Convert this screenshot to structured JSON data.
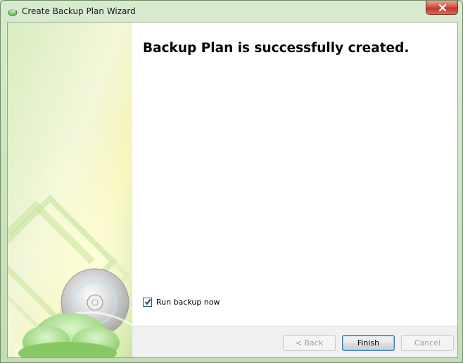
{
  "window": {
    "title": "Create Backup Plan Wizard"
  },
  "content": {
    "heading": "Backup Plan is successfully created.",
    "run_backup": {
      "label": "Run backup now",
      "checked": true
    }
  },
  "buttons": {
    "back": {
      "label": "< Back",
      "enabled": false
    },
    "finish": {
      "label": "Finish",
      "enabled": true,
      "default": true
    },
    "cancel": {
      "label": "Cancel",
      "enabled": false
    }
  },
  "colors": {
    "side_panel_green": "#b6dc8e",
    "side_panel_yellow": "#f7f5b8",
    "content_bg": "#ffffff",
    "button_bar_bg": "#f0f0f0",
    "close_red": "#c0392b"
  },
  "icons": {
    "app": "cloud-backup-icon",
    "close": "close-icon",
    "side_art": "cd-disc-icon"
  }
}
